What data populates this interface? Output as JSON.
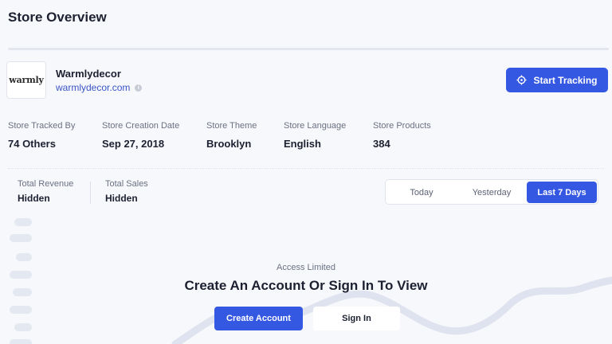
{
  "page": {
    "title": "Store Overview"
  },
  "store": {
    "logo_text": "warmly",
    "name": "Warmlydecor",
    "url": "warmlydecor.com",
    "info_glyph": "i"
  },
  "actions": {
    "start_tracking": "Start Tracking",
    "start_tracking_icon": "crosshair-icon"
  },
  "stats": [
    {
      "label": "Store Tracked By",
      "value": "74 Others"
    },
    {
      "label": "Store Creation Date",
      "value": "Sep 27, 2018"
    },
    {
      "label": "Store Theme",
      "value": "Brooklyn"
    },
    {
      "label": "Store Language",
      "value": "English"
    },
    {
      "label": "Store Products",
      "value": "384"
    }
  ],
  "metrics": [
    {
      "label": "Total Revenue",
      "value": "Hidden"
    },
    {
      "label": "Total Sales",
      "value": "Hidden"
    }
  ],
  "ranges": [
    {
      "label": "Today",
      "active": false
    },
    {
      "label": "Yesterday",
      "active": false
    },
    {
      "label": "Last 7 Days",
      "active": true
    }
  ],
  "access": {
    "subtitle": "Access Limited",
    "title": "Create An Account Or Sign In To View",
    "create_label": "Create Account",
    "signin_label": "Sign In"
  },
  "colors": {
    "accent": "#3558e3",
    "background": "#f7f8fb",
    "blurred_chart": "#dfe3ef"
  }
}
